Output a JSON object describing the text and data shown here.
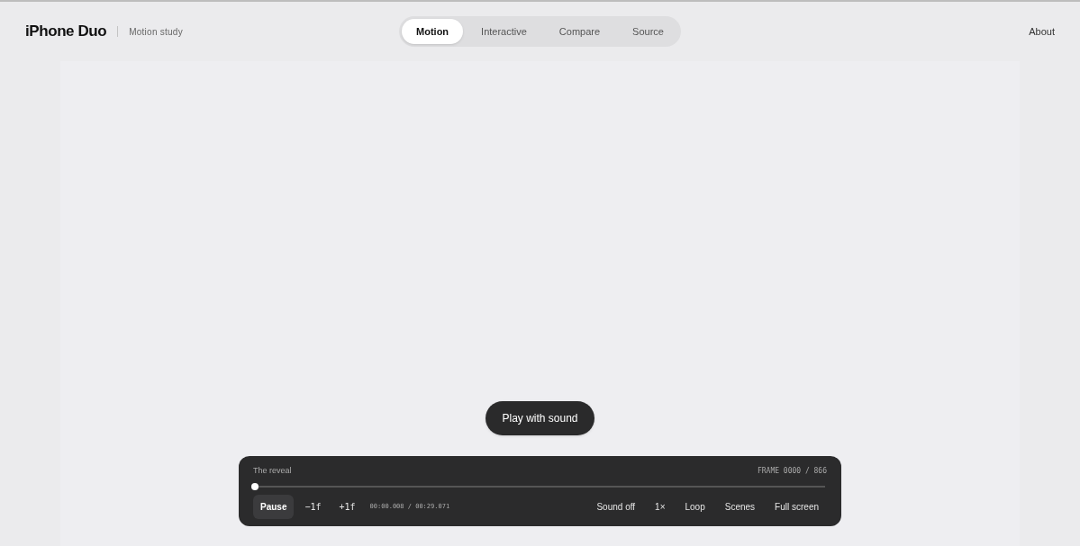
{
  "header": {
    "brand": "iPhone Duo",
    "subtitle": "Motion study",
    "about": "About"
  },
  "tabs": [
    {
      "label": "Motion",
      "selected": true
    },
    {
      "label": "Interactive",
      "selected": false
    },
    {
      "label": "Compare",
      "selected": false
    },
    {
      "label": "Source",
      "selected": false
    }
  ],
  "stage": {
    "play_button": "Play with sound"
  },
  "player": {
    "scene": "The reveal",
    "frame": "FRAME 0000 / 866",
    "scrubber": {
      "level": 0
    },
    "left_controls": [
      {
        "label": "Pause",
        "kind": "primary"
      },
      {
        "label": "−1f",
        "kind": "mono"
      },
      {
        "label": "+1f",
        "kind": "mono"
      }
    ],
    "time": "00:00.008 / 00:29.071",
    "right_controls": [
      "Sound off",
      "1×",
      "Loop",
      "Scenes",
      "Full screen"
    ]
  }
}
